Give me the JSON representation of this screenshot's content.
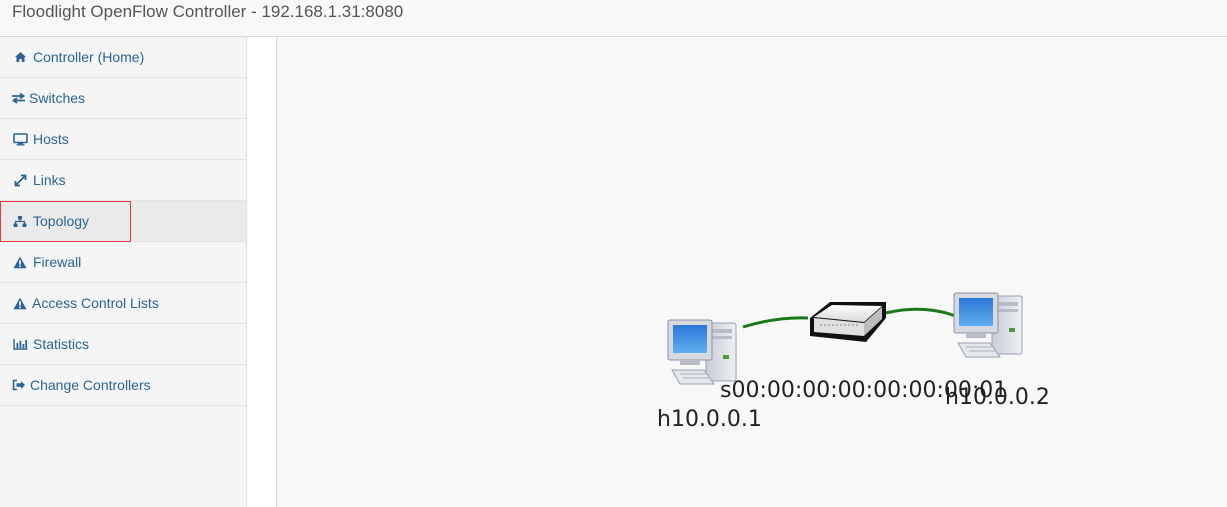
{
  "header": {
    "title": "Floodlight OpenFlow Controller - 192.168.1.31:8080"
  },
  "sidebar": {
    "items": [
      {
        "label": "Controller (Home)",
        "icon": "home-icon"
      },
      {
        "label": "Switches",
        "icon": "exchange-icon"
      },
      {
        "label": "Hosts",
        "icon": "desktop-icon"
      },
      {
        "label": "Links",
        "icon": "resize-icon"
      },
      {
        "label": "Topology",
        "icon": "sitemap-icon",
        "active": true
      },
      {
        "label": "Firewall",
        "icon": "warning-icon"
      },
      {
        "label": "Access Control Lists",
        "icon": "warning-icon"
      },
      {
        "label": "Statistics",
        "icon": "bar-chart-icon"
      },
      {
        "label": "Change Controllers",
        "icon": "sign-out-icon"
      }
    ]
  },
  "topology": {
    "hosts": [
      {
        "label": "h10.0.0.1",
        "icon": "computer-icon"
      },
      {
        "label": "h10.0.0.2",
        "icon": "computer-icon"
      }
    ],
    "switches": [
      {
        "label": "s00:00:00:00:00:00:00:01",
        "icon": "switch-icon"
      }
    ],
    "link_color": "#1a7a1a"
  },
  "colors": {
    "link_text": "#2a6496",
    "highlight_border": "#e0393e"
  }
}
